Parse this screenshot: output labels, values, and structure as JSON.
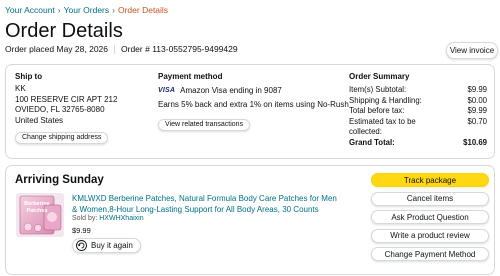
{
  "breadcrumb": {
    "items": [
      "Your Account",
      "Your Orders",
      "Order Details"
    ],
    "separator": "›"
  },
  "page": {
    "title": "Order Details",
    "order_placed": "Order placed May 28, 2026",
    "order_number": "Order # 113-0552795-9499429",
    "view_invoice": "View invoice"
  },
  "ship_to": {
    "title": "Ship to",
    "name": "KK",
    "address_line1": "100 RESERVE CIR APT 212",
    "address_line2": "OVIEDO, FL 32765-8080",
    "country": "United States",
    "change_button": "Change shipping address"
  },
  "payment": {
    "title": "Payment method",
    "card_brand": "VISA",
    "card_text": "Amazon Visa ending in 9087",
    "earns_text": "Earns 5% back and extra 1% on items using No-Rush",
    "related_button": "View related transactions"
  },
  "order_summary": {
    "title": "Order Summary",
    "rows": [
      {
        "label": "Item(s) Subtotal:",
        "value": "$9.99"
      },
      {
        "label": "Shipping & Handling:",
        "value": "$0.00"
      },
      {
        "label": "Total before tax:",
        "value": "$9.99"
      },
      {
        "label": "Estimated tax to be collected:",
        "value": "$0.70"
      }
    ],
    "grand_total": {
      "label": "Grand Total:",
      "value": "$10.69"
    }
  },
  "shipment": {
    "status": "Arriving Sunday",
    "product_title": "KMLWXD Berberine Patches, Natural Formula Body Care Patches for Men & Women,8-Hour Long-Lasting Support for All Body Areas, 30 Counts",
    "sold_by_label": "Sold by:",
    "seller": "HXWHXhaixin",
    "price": "$9.99",
    "buy_again": "Buy it again",
    "product_image_text_1": "Berberine",
    "product_image_text_2": "Patches",
    "actions": {
      "track": "Track package",
      "cancel": "Cancel items",
      "ask": "Ask Product Question",
      "review": "Write a product review",
      "change_payment": "Change Payment Method"
    }
  },
  "colors": {
    "link": "#007185",
    "current_crumb": "#c7511f",
    "primary_button": "#ffd814",
    "border": "#d5d9d9",
    "text": "#0f1111"
  }
}
